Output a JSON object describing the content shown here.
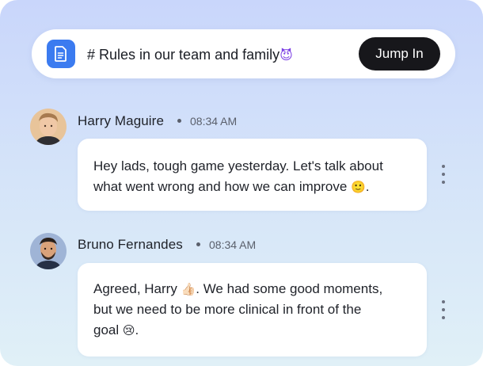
{
  "channel": {
    "icon": "document-icon",
    "title": "# Rules in our team and family",
    "title_emoji": "😈"
  },
  "jump_button": {
    "label": "Jump In"
  },
  "messages": [
    {
      "author": "Harry Maguire",
      "time": "08:34 AM",
      "avatar": "avatar-harry",
      "lines": [
        "Hey lads, tough game yesterday. Let's talk about",
        "what went wrong and how we can improve"
      ],
      "line2_tail": ".",
      "emoji": "🙂"
    },
    {
      "author": "Bruno Fernandes",
      "time": "08:34 AM",
      "avatar": "avatar-bruno",
      "lines": [
        "Agreed, Harry",
        ". We had some good moments,",
        "but we need to be more clinical in front of the",
        "goal",
        "."
      ],
      "emoji_thumb": "👍🏻",
      "emoji_end": "😢"
    }
  ],
  "colors": {
    "accent": "#3b7bf0",
    "button_bg": "#17171b",
    "gradient_top": "#c9d6fb",
    "gradient_bottom": "#e0f0f7"
  }
}
